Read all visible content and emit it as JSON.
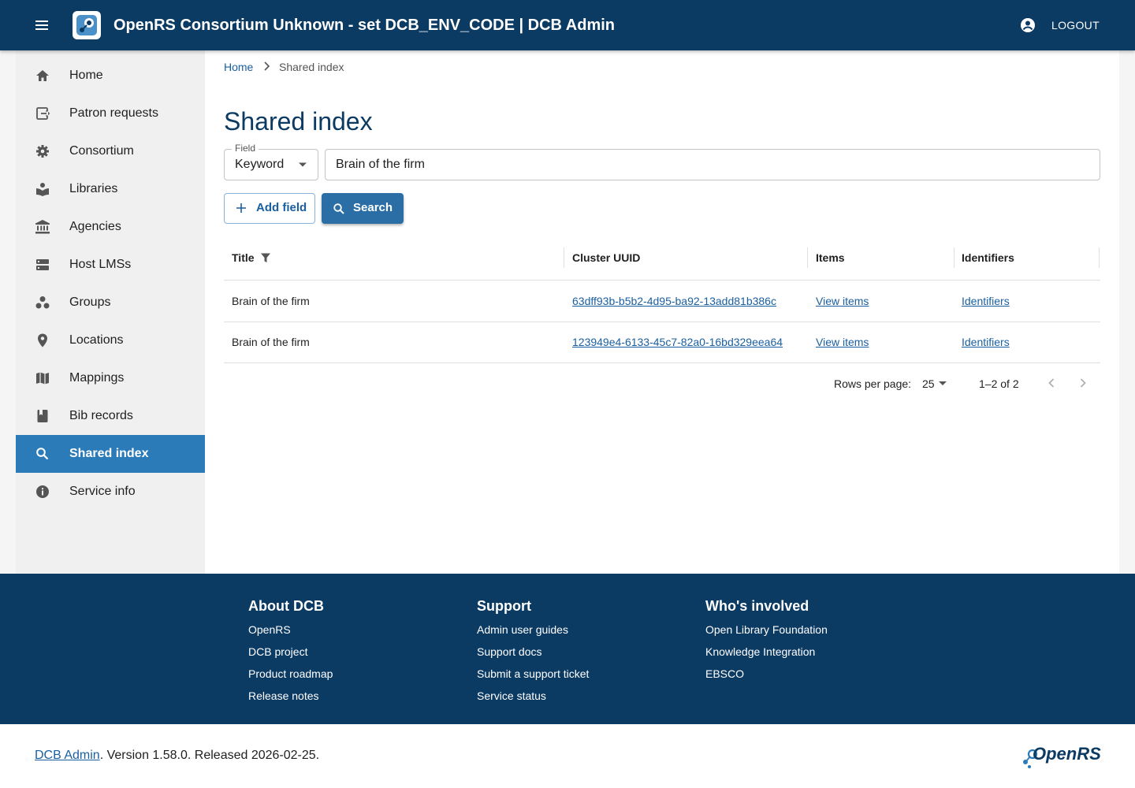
{
  "app": {
    "title": "OpenRS Consortium Unknown - set DCB_ENV_CODE | DCB Admin",
    "logout_label": "LOGOUT"
  },
  "sidebar": {
    "items": [
      {
        "label": "Home",
        "icon": "home-icon"
      },
      {
        "label": "Patron requests",
        "icon": "exit-to-app-icon"
      },
      {
        "label": "Consortium",
        "icon": "gear-icon"
      },
      {
        "label": "Libraries",
        "icon": "local-library-icon"
      },
      {
        "label": "Agencies",
        "icon": "account-balance-icon"
      },
      {
        "label": "Host LMSs",
        "icon": "storage-icon"
      },
      {
        "label": "Groups",
        "icon": "workspaces-icon"
      },
      {
        "label": "Locations",
        "icon": "location-pin-icon"
      },
      {
        "label": "Mappings",
        "icon": "map-icon"
      },
      {
        "label": "Bib records",
        "icon": "book-icon"
      },
      {
        "label": "Shared index",
        "icon": "search-icon"
      },
      {
        "label": "Service info",
        "icon": "info-icon"
      }
    ],
    "active": "Shared index"
  },
  "breadcrumb": {
    "home": "Home",
    "current": "Shared index"
  },
  "page": {
    "title": "Shared index"
  },
  "search": {
    "field_legend": "Field",
    "field_value": "Keyword",
    "query": "Brain of the firm",
    "add_field_label": "Add field",
    "search_label": "Search"
  },
  "table": {
    "headers": {
      "title": "Title",
      "cluster": "Cluster UUID",
      "items": "Items",
      "identifiers": "Identifiers"
    },
    "rows": [
      {
        "title": "Brain of the firm",
        "cluster": "63dff93b-b5b2-4d95-ba92-13add81b386c",
        "items": "View items",
        "identifiers": "Identifiers"
      },
      {
        "title": "Brain of the firm",
        "cluster": "123949e4-6133-45c7-82a0-16bd329eea64",
        "items": "View items",
        "identifiers": "Identifiers"
      }
    ]
  },
  "pagination": {
    "rows_label": "Rows per page:",
    "rows_value": "25",
    "range": "1–2 of 2"
  },
  "footer": {
    "about": {
      "heading": "About DCB",
      "links": [
        "OpenRS",
        "DCB project",
        "Product roadmap",
        "Release notes"
      ]
    },
    "support": {
      "heading": "Support",
      "links": [
        "Admin user guides",
        "Support docs",
        "Submit a support ticket",
        "Service status"
      ]
    },
    "involved": {
      "heading": "Who's involved",
      "links": [
        "Open Library Foundation",
        "Knowledge Integration",
        "EBSCO"
      ]
    }
  },
  "version": {
    "app_link": "DCB Admin",
    "text": ". Version 1.58.0. Released 2026-02-25."
  },
  "brand": {
    "name": "OpenRS"
  },
  "colors": {
    "primary": "#0b3a63",
    "accent": "#2b7bb9",
    "link": "#1a5fa0"
  }
}
